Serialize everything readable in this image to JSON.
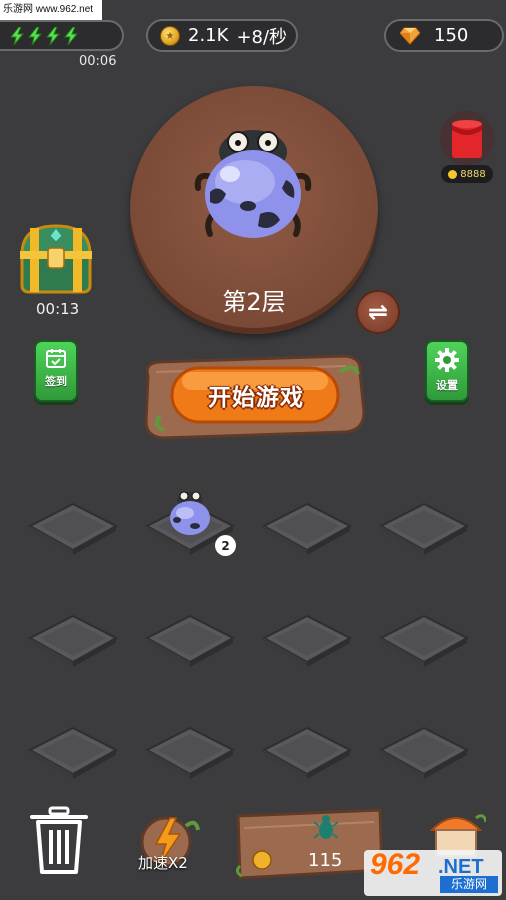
{
  "watermark_top": "乐游网 www.962.net",
  "energy": {
    "bolts": 4,
    "timer": "00:06"
  },
  "coins": {
    "amount": "2.1K",
    "rate": "+8/秒"
  },
  "gems": {
    "amount": "150"
  },
  "stage": {
    "level_label": "第2层",
    "swap_symbol": "⇌"
  },
  "chest": {
    "timer": "00:13"
  },
  "red_packet": {
    "coins": "8888"
  },
  "buttons": {
    "signin": "签到",
    "settings": "设置",
    "start": "开始游戏"
  },
  "grid": {
    "rows": 3,
    "cols": 4,
    "occupied": [
      {
        "row": 0,
        "col": 1,
        "level": "2"
      }
    ]
  },
  "bottom": {
    "speed_label": "加速X2",
    "buy_price": "115"
  },
  "watermark_bottom": {
    "brand": "962",
    "suffix": ".NET",
    "cn": "乐游网"
  },
  "colors": {
    "background": "#3c3c3e",
    "stage": "#7a4a36",
    "green_button": "#3bb548",
    "start_orange": "#f07a17",
    "wood": "#9c6b4f"
  }
}
